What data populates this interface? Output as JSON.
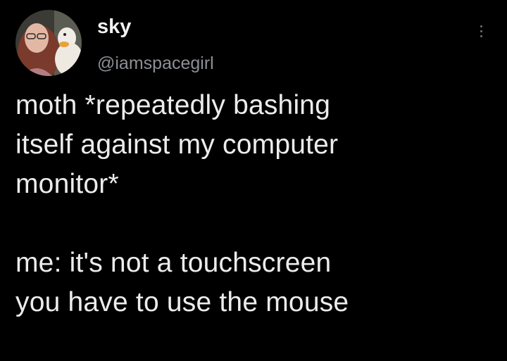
{
  "tweet": {
    "author": {
      "display_name": "sky",
      "handle": "@iamspacegirl"
    },
    "body": {
      "paragraph_1": "moth *repeatedly bashing\nitself against my computer\nmonitor*",
      "paragraph_2": "me: it's not a touchscreen\nyou have to use the mouse"
    },
    "more_icon": "more-vertical-icon"
  },
  "colors": {
    "background": "#000000",
    "text": "#ececec",
    "handle": "#8c8f93"
  }
}
